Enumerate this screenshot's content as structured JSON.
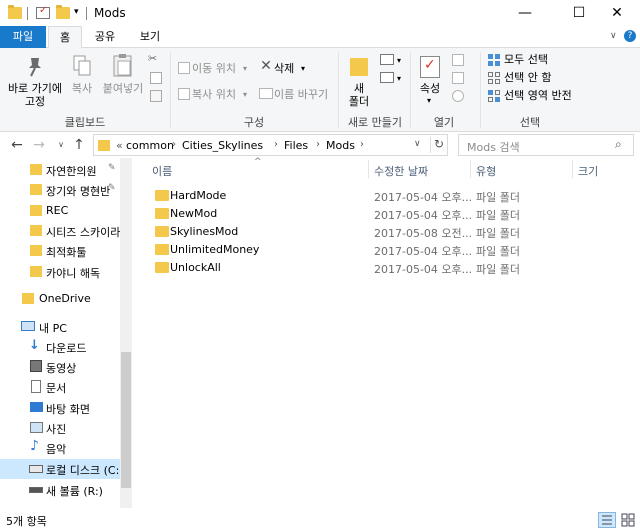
{
  "window": {
    "title": "Mods",
    "min_symbol": "—",
    "max_symbol": "☐",
    "close_symbol": "✕"
  },
  "tabs": {
    "file": "파일",
    "home": "홈",
    "share": "공유",
    "view": "보기"
  },
  "ribbon": {
    "pin_quick": "바로 가기에\n고정",
    "copy": "복사",
    "paste": "붙여넣기",
    "clipboard_group": "클립보드",
    "move_to": "이동 위치",
    "copy_to": "복사 위치",
    "delete": "삭제",
    "rename": "이름 바꾸기",
    "organize_group": "구성",
    "new_folder": "새\n폴더",
    "new_group": "새로 만들기",
    "properties": "속성",
    "open_group": "열기",
    "select_all": "모두 선택",
    "select_none": "선택 안 함",
    "invert_selection": "선택 영역 반전",
    "select_group": "선택"
  },
  "address": {
    "overflow": "«",
    "crumbs": [
      "common",
      "Cities_Skylines",
      "Files",
      "Mods"
    ],
    "search_placeholder": "Mods 검색"
  },
  "nav": {
    "quick": [
      "자연한의원",
      "장기와 명현반",
      "REC",
      "시티즈 스카이라",
      "최적화툴",
      "카야니 해독"
    ],
    "onedrive": "OneDrive",
    "this_pc": "내 PC",
    "pc_items": [
      "다운로드",
      "동영상",
      "문서",
      "바탕 화면",
      "사진",
      "음악",
      "로컬 디스크 (C:)",
      "새 볼륨 (R:)"
    ]
  },
  "columns": {
    "name": "이름",
    "date": "수정한 날짜",
    "type": "유형",
    "size": "크기"
  },
  "files": [
    {
      "name": "HardMode",
      "date": "2017-05-04 오후...",
      "type": "파일 폴더"
    },
    {
      "name": "NewMod",
      "date": "2017-05-04 오후...",
      "type": "파일 폴더"
    },
    {
      "name": "SkylinesMod",
      "date": "2017-05-08 오전...",
      "type": "파일 폴더"
    },
    {
      "name": "UnlimitedMoney",
      "date": "2017-05-04 오후...",
      "type": "파일 폴더"
    },
    {
      "name": "UnlockAll",
      "date": "2017-05-04 오후...",
      "type": "파일 폴더"
    }
  ],
  "status": {
    "count": "5개 항목"
  },
  "colors": {
    "accent": "#1979ca",
    "folder": "#f3c84b",
    "selection": "#cce8ff"
  }
}
